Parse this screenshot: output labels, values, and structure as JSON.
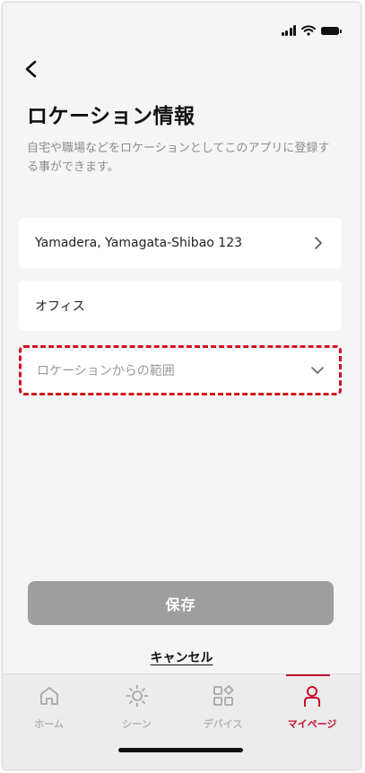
{
  "screen": {
    "title": "ロケーション情報",
    "description": "自宅や職場などをロケーションとしてこのアプリに登録する事ができます。"
  },
  "fields": {
    "address": {
      "value": "Yamadera, Yamagata-Shibao 123",
      "icon": "chevron-right-icon"
    },
    "location_name": {
      "value": "オフィス"
    },
    "range": {
      "placeholder": "ロケーションからの範囲",
      "icon": "chevron-down-icon",
      "highlight_color": "#d0121b"
    }
  },
  "actions": {
    "save_label": "保存",
    "cancel_label": "キャンセル"
  },
  "tabbar": {
    "active_color": "#c8102e",
    "items": [
      {
        "label": "ホーム",
        "icon": "home-icon",
        "active": false
      },
      {
        "label": "シーン",
        "icon": "sun-icon",
        "active": false
      },
      {
        "label": "デバイス",
        "icon": "devices-grid-icon",
        "active": false
      },
      {
        "label": "マイページ",
        "icon": "person-icon",
        "active": true
      }
    ]
  }
}
